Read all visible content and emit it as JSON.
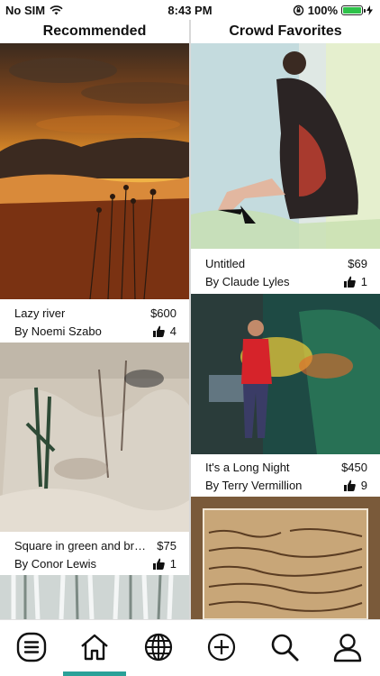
{
  "status": {
    "carrier": "No SIM",
    "time": "8:43 PM",
    "battery": "100%",
    "battery_level": 1.0
  },
  "columns": {
    "left_title": "Recommended",
    "right_title": "Crowd Favorites"
  },
  "recommended": [
    {
      "title": "Lazy river",
      "price": "$600",
      "artist": "By  Noemi Szabo",
      "likes": "4"
    },
    {
      "title": "Square in green and bro...",
      "price": "$75",
      "artist": "By  Conor Lewis",
      "likes": "1"
    }
  ],
  "favorites": [
    {
      "title": "Untitled",
      "price": "$69",
      "artist": "By  Claude Lyles",
      "likes": "1"
    },
    {
      "title": "It's a Long Night",
      "price": "$450",
      "artist": "By  Terry Vermillion",
      "likes": "9"
    }
  ],
  "tabs": [
    "menu-icon",
    "home-icon",
    "globe-icon",
    "add-icon",
    "search-icon",
    "profile-icon"
  ],
  "active_tab": "home-icon",
  "colors": {
    "accent": "#2aa198",
    "battery": "#2ec24a"
  }
}
